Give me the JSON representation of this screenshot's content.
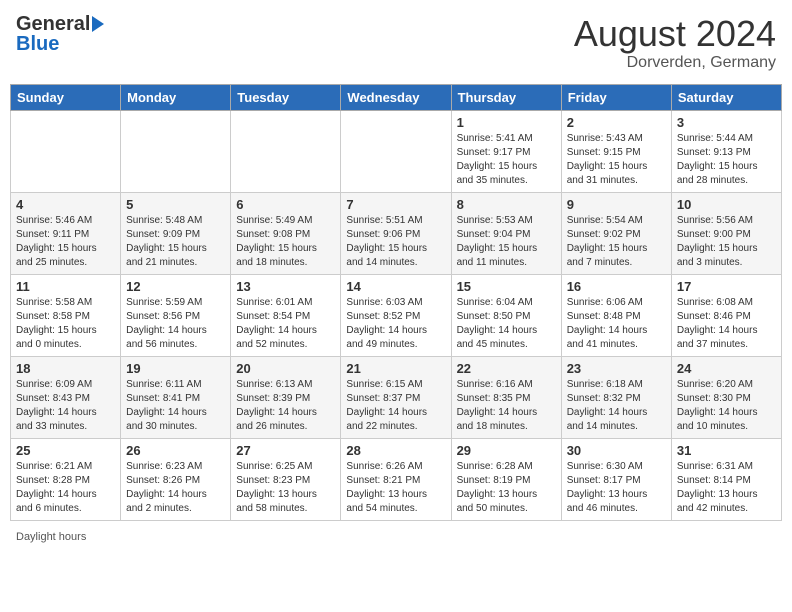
{
  "header": {
    "logo_general": "General",
    "logo_blue": "Blue",
    "title": "August 2024",
    "location": "Dorverden, Germany"
  },
  "days_of_week": [
    "Sunday",
    "Monday",
    "Tuesday",
    "Wednesday",
    "Thursday",
    "Friday",
    "Saturday"
  ],
  "weeks": [
    [
      {
        "day": "",
        "info": ""
      },
      {
        "day": "",
        "info": ""
      },
      {
        "day": "",
        "info": ""
      },
      {
        "day": "",
        "info": ""
      },
      {
        "day": "1",
        "info": "Sunrise: 5:41 AM\nSunset: 9:17 PM\nDaylight: 15 hours\nand 35 minutes."
      },
      {
        "day": "2",
        "info": "Sunrise: 5:43 AM\nSunset: 9:15 PM\nDaylight: 15 hours\nand 31 minutes."
      },
      {
        "day": "3",
        "info": "Sunrise: 5:44 AM\nSunset: 9:13 PM\nDaylight: 15 hours\nand 28 minutes."
      }
    ],
    [
      {
        "day": "4",
        "info": "Sunrise: 5:46 AM\nSunset: 9:11 PM\nDaylight: 15 hours\nand 25 minutes."
      },
      {
        "day": "5",
        "info": "Sunrise: 5:48 AM\nSunset: 9:09 PM\nDaylight: 15 hours\nand 21 minutes."
      },
      {
        "day": "6",
        "info": "Sunrise: 5:49 AM\nSunset: 9:08 PM\nDaylight: 15 hours\nand 18 minutes."
      },
      {
        "day": "7",
        "info": "Sunrise: 5:51 AM\nSunset: 9:06 PM\nDaylight: 15 hours\nand 14 minutes."
      },
      {
        "day": "8",
        "info": "Sunrise: 5:53 AM\nSunset: 9:04 PM\nDaylight: 15 hours\nand 11 minutes."
      },
      {
        "day": "9",
        "info": "Sunrise: 5:54 AM\nSunset: 9:02 PM\nDaylight: 15 hours\nand 7 minutes."
      },
      {
        "day": "10",
        "info": "Sunrise: 5:56 AM\nSunset: 9:00 PM\nDaylight: 15 hours\nand 3 minutes."
      }
    ],
    [
      {
        "day": "11",
        "info": "Sunrise: 5:58 AM\nSunset: 8:58 PM\nDaylight: 15 hours\nand 0 minutes."
      },
      {
        "day": "12",
        "info": "Sunrise: 5:59 AM\nSunset: 8:56 PM\nDaylight: 14 hours\nand 56 minutes."
      },
      {
        "day": "13",
        "info": "Sunrise: 6:01 AM\nSunset: 8:54 PM\nDaylight: 14 hours\nand 52 minutes."
      },
      {
        "day": "14",
        "info": "Sunrise: 6:03 AM\nSunset: 8:52 PM\nDaylight: 14 hours\nand 49 minutes."
      },
      {
        "day": "15",
        "info": "Sunrise: 6:04 AM\nSunset: 8:50 PM\nDaylight: 14 hours\nand 45 minutes."
      },
      {
        "day": "16",
        "info": "Sunrise: 6:06 AM\nSunset: 8:48 PM\nDaylight: 14 hours\nand 41 minutes."
      },
      {
        "day": "17",
        "info": "Sunrise: 6:08 AM\nSunset: 8:46 PM\nDaylight: 14 hours\nand 37 minutes."
      }
    ],
    [
      {
        "day": "18",
        "info": "Sunrise: 6:09 AM\nSunset: 8:43 PM\nDaylight: 14 hours\nand 33 minutes."
      },
      {
        "day": "19",
        "info": "Sunrise: 6:11 AM\nSunset: 8:41 PM\nDaylight: 14 hours\nand 30 minutes."
      },
      {
        "day": "20",
        "info": "Sunrise: 6:13 AM\nSunset: 8:39 PM\nDaylight: 14 hours\nand 26 minutes."
      },
      {
        "day": "21",
        "info": "Sunrise: 6:15 AM\nSunset: 8:37 PM\nDaylight: 14 hours\nand 22 minutes."
      },
      {
        "day": "22",
        "info": "Sunrise: 6:16 AM\nSunset: 8:35 PM\nDaylight: 14 hours\nand 18 minutes."
      },
      {
        "day": "23",
        "info": "Sunrise: 6:18 AM\nSunset: 8:32 PM\nDaylight: 14 hours\nand 14 minutes."
      },
      {
        "day": "24",
        "info": "Sunrise: 6:20 AM\nSunset: 8:30 PM\nDaylight: 14 hours\nand 10 minutes."
      }
    ],
    [
      {
        "day": "25",
        "info": "Sunrise: 6:21 AM\nSunset: 8:28 PM\nDaylight: 14 hours\nand 6 minutes."
      },
      {
        "day": "26",
        "info": "Sunrise: 6:23 AM\nSunset: 8:26 PM\nDaylight: 14 hours\nand 2 minutes."
      },
      {
        "day": "27",
        "info": "Sunrise: 6:25 AM\nSunset: 8:23 PM\nDaylight: 13 hours\nand 58 minutes."
      },
      {
        "day": "28",
        "info": "Sunrise: 6:26 AM\nSunset: 8:21 PM\nDaylight: 13 hours\nand 54 minutes."
      },
      {
        "day": "29",
        "info": "Sunrise: 6:28 AM\nSunset: 8:19 PM\nDaylight: 13 hours\nand 50 minutes."
      },
      {
        "day": "30",
        "info": "Sunrise: 6:30 AM\nSunset: 8:17 PM\nDaylight: 13 hours\nand 46 minutes."
      },
      {
        "day": "31",
        "info": "Sunrise: 6:31 AM\nSunset: 8:14 PM\nDaylight: 13 hours\nand 42 minutes."
      }
    ]
  ],
  "footer": {
    "daylight_label": "Daylight hours"
  }
}
